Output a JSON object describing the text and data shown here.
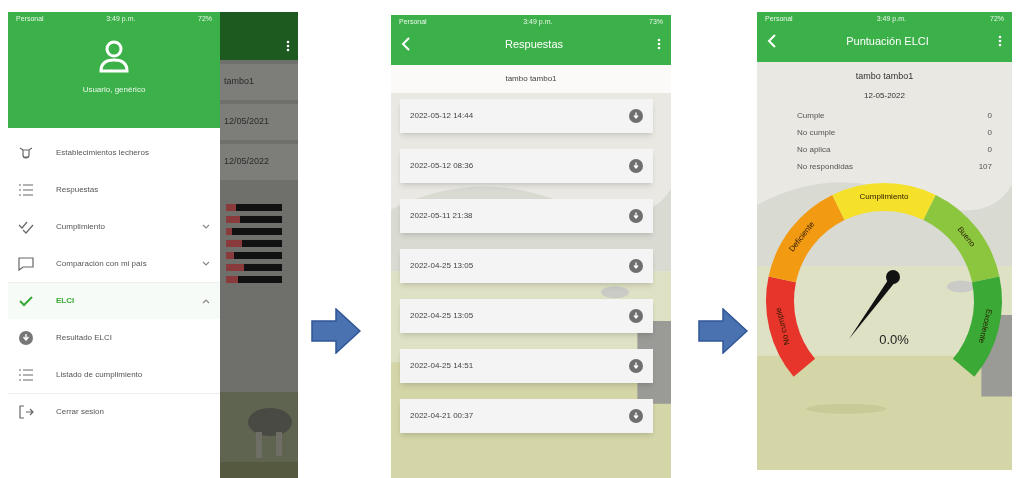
{
  "screens": [
    {
      "kind": "drawer",
      "status_bar": {
        "carrier": "Personal",
        "time": "3:49 p.m.",
        "battery": "72%"
      },
      "user_name": "Usuario, genérico",
      "menu": [
        {
          "kind": "link",
          "label": "Establecimientos lecheros",
          "selected": false
        },
        {
          "kind": "link",
          "label": "Respuestas",
          "selected": false
        },
        {
          "kind": "group",
          "label": "Cumplimiento",
          "selected": false,
          "expanded": false
        },
        {
          "kind": "group",
          "label": "Comparación con mi país",
          "selected": false,
          "expanded": false
        },
        {
          "kind": "group",
          "label": "ELCI",
          "selected": true,
          "expanded": true
        },
        {
          "kind": "link",
          "label": "Resultado ELCI",
          "selected": false
        },
        {
          "kind": "link",
          "label": "Listado de cumplimiento",
          "selected": false
        },
        {
          "kind": "link",
          "label": "Cerrar sesion",
          "selected": false
        }
      ],
      "behind": {
        "rows": [
          "tambo1",
          "12/05/2021",
          "12/05/2022"
        ]
      }
    },
    {
      "kind": "list",
      "status_bar": {
        "carrier": "Personal",
        "time": "3:49 p.m.",
        "battery": "73%"
      },
      "title": "Respuestas",
      "subtitle": "tambo tambo1",
      "items": [
        "2022-05-12 14:44",
        "2022-05-12 08:36",
        "2022-05-11 21:38",
        "2022-04-25 13:05",
        "2022-04-25 13:05",
        "2022-04-25 14:51",
        "2022-04-21 00:37"
      ]
    },
    {
      "kind": "score",
      "status_bar": {
        "carrier": "Personal",
        "time": "3:49 p.m.",
        "battery": "72%"
      },
      "title": "Puntuación ELCI",
      "subtitle": "tambo tambo1",
      "date": "12-05-2022",
      "stats": [
        {
          "label": "Cumple",
          "value": "0"
        },
        {
          "label": "No cumple",
          "value": "0"
        },
        {
          "label": "No aplica",
          "value": "0"
        },
        {
          "label": "No respondidas",
          "value": "107"
        }
      ],
      "gauge": {
        "reading": "0.0%",
        "bands": [
          {
            "label": "No cumple",
            "color": "#e8352b"
          },
          {
            "label": "Deficiente",
            "color": "#f29a12"
          },
          {
            "label": "Cumplimiento",
            "color": "#f5e12a"
          },
          {
            "label": "Bueno",
            "color": "#8cc63f"
          },
          {
            "label": "Excelente",
            "color": "#3aa935"
          }
        ]
      }
    }
  ]
}
